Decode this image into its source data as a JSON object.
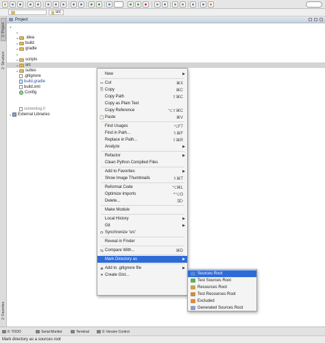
{
  "toolbar": {
    "run_config_value": "",
    "buttons": [
      {
        "name": "open-icon",
        "color": "#c8a24a"
      },
      {
        "name": "save-icon",
        "color": "#6d87b6"
      },
      {
        "name": "sync-icon",
        "color": "#3f8f3f"
      },
      {
        "name": "undo-icon",
        "color": "#7a7a7a"
      },
      {
        "name": "redo-icon",
        "color": "#7a7a7a"
      },
      {
        "name": "cut-icon",
        "color": "#7a7a7a"
      },
      {
        "name": "copy-icon",
        "color": "#7a7a7a"
      },
      {
        "name": "paste-icon",
        "color": "#7a7a7a"
      },
      {
        "name": "find-icon",
        "color": "#5a79b4"
      },
      {
        "name": "replace-icon",
        "color": "#5a79b4"
      },
      {
        "name": "back-icon",
        "color": "#4a8f4a"
      },
      {
        "name": "forward-icon",
        "color": "#4a8f4a"
      },
      {
        "name": "build-icon",
        "color": "#4b7fc0"
      },
      {
        "name": "run-icon",
        "color": "#37a237"
      },
      {
        "name": "debug-icon",
        "color": "#4b9e4b"
      },
      {
        "name": "stop-icon",
        "color": "#c63b3b"
      },
      {
        "name": "settings-icon",
        "color": "#888888"
      },
      {
        "name": "structure-icon",
        "color": "#6f7fa5"
      },
      {
        "name": "sdk-icon",
        "color": "#6aa35b"
      },
      {
        "name": "avd-icon",
        "color": "#6aa35b"
      },
      {
        "name": "monitor-icon",
        "color": "#6f7fa5"
      },
      {
        "name": "help-icon",
        "color": "#5a79b4"
      },
      {
        "name": "vcs-icon",
        "color": "#d08a3a"
      }
    ]
  },
  "breadcrumb": {
    "root": "",
    "current": "src"
  },
  "side_tabs": {
    "project": "1: Project",
    "structure": "2: Structure",
    "favorites": "2: Favorites"
  },
  "project_pane": {
    "title": "Project",
    "tree": [
      {
        "label": "",
        "kind": "blank",
        "indent": 0,
        "twisty": "▾"
      },
      {
        "label": "",
        "kind": "blank",
        "indent": 1,
        "twisty": "▸"
      },
      {
        "label": ".idea",
        "kind": "folder",
        "indent": 1,
        "twisty": "▸"
      },
      {
        "label": "build",
        "kind": "folder",
        "indent": 1,
        "twisty": "▸"
      },
      {
        "label": "gradle",
        "kind": "folder",
        "indent": 1,
        "twisty": "▸"
      },
      {
        "label": "",
        "kind": "blank",
        "indent": 1,
        "twisty": "▸"
      },
      {
        "label": "scripts",
        "kind": "folder",
        "indent": 1,
        "twisty": "▸"
      },
      {
        "label": "src",
        "kind": "folder",
        "indent": 1,
        "twisty": "▸",
        "selected": true
      },
      {
        "label": "suites",
        "kind": "folder",
        "indent": 1,
        "twisty": "▸"
      },
      {
        "label": ".gitignore",
        "kind": "file",
        "indent": 1,
        "twisty": ""
      },
      {
        "label": "build.gradle",
        "kind": "file-blue",
        "indent": 1,
        "twisty": ""
      },
      {
        "label": "build.xml",
        "kind": "file",
        "indent": 1,
        "twisty": ""
      },
      {
        "label": "Config",
        "kind": "gear",
        "indent": 1,
        "twisty": ""
      },
      {
        "label": "",
        "kind": "blank",
        "indent": 1,
        "twisty": ""
      },
      {
        "label": "",
        "kind": "blank",
        "indent": 1,
        "twisty": ""
      },
      {
        "label": "screenlog.0",
        "kind": "file-gray",
        "indent": 1,
        "twisty": ""
      },
      {
        "label": "External Libraries",
        "kind": "lib",
        "indent": 0,
        "twisty": "▸"
      }
    ]
  },
  "context_menu": {
    "items": [
      {
        "label": "New",
        "shortcut": "",
        "submenu": true,
        "icon": ""
      },
      {
        "sep": true
      },
      {
        "label": "Cut",
        "shortcut": "⌘X",
        "icon": "✂"
      },
      {
        "label": "Copy",
        "shortcut": "⌘C",
        "icon": "⎘"
      },
      {
        "label": "Copy Path",
        "shortcut": "⇧⌘C",
        "icon": ""
      },
      {
        "label": "Copy as Plain Text",
        "shortcut": "",
        "icon": ""
      },
      {
        "label": "Copy Reference",
        "shortcut": "⌥⇧⌘C",
        "icon": ""
      },
      {
        "label": "Paste",
        "shortcut": "⌘V",
        "icon": "📋"
      },
      {
        "sep": true
      },
      {
        "label": "Find Usages",
        "shortcut": "⌥F7",
        "icon": ""
      },
      {
        "label": "Find in Path...",
        "shortcut": "⇧⌘F",
        "icon": ""
      },
      {
        "label": "Replace in Path...",
        "shortcut": "⇧⌘R",
        "icon": ""
      },
      {
        "label": "Analyze",
        "shortcut": "",
        "submenu": true,
        "icon": ""
      },
      {
        "sep": true
      },
      {
        "label": "Refactor",
        "shortcut": "",
        "submenu": true,
        "icon": ""
      },
      {
        "label": "Clean Python Compiled Files",
        "shortcut": "",
        "icon": ""
      },
      {
        "sep": true
      },
      {
        "label": "Add to Favorites",
        "shortcut": "",
        "submenu": true,
        "icon": ""
      },
      {
        "label": "Show Image Thumbnails",
        "shortcut": "⇧⌘T",
        "icon": ""
      },
      {
        "sep": true
      },
      {
        "label": "Reformat Code",
        "shortcut": "⌥⌘L",
        "icon": ""
      },
      {
        "label": "Optimize Imports",
        "shortcut": "^⌥O",
        "icon": ""
      },
      {
        "label": "Delete...",
        "shortcut": "⌦",
        "icon": ""
      },
      {
        "sep": true
      },
      {
        "label": "Make Module",
        "shortcut": "",
        "icon": ""
      },
      {
        "sep": true
      },
      {
        "label": "Local History",
        "shortcut": "",
        "submenu": true,
        "icon": ""
      },
      {
        "label": "Git",
        "shortcut": "",
        "submenu": true,
        "icon": ""
      },
      {
        "label": "Synchronize 'src'",
        "shortcut": "",
        "icon": "⟳"
      },
      {
        "sep": true
      },
      {
        "label": "Reveal in Finder",
        "shortcut": "",
        "icon": ""
      },
      {
        "sep": true
      },
      {
        "label": "Compare With...",
        "shortcut": "⌘D",
        "icon": "⇆"
      },
      {
        "sep": true
      },
      {
        "label": "Mark Directory as",
        "shortcut": "",
        "submenu": true,
        "icon": "",
        "highlighted": true
      },
      {
        "sep": true
      },
      {
        "label": "Add to .gitignore file",
        "shortcut": "",
        "submenu": true,
        "icon": "◈"
      },
      {
        "label": "Create Gist...",
        "shortcut": "",
        "icon": "●"
      }
    ]
  },
  "mark_submenu": {
    "items": [
      {
        "label": "Sources Root",
        "color": "#5b84d6",
        "highlighted": true
      },
      {
        "label": "Test Sources Root",
        "color": "#5fae5f"
      },
      {
        "label": "Resources Root",
        "color": "#c9a24e"
      },
      {
        "label": "Test Resources Root",
        "color": "#c98c4e"
      },
      {
        "label": "Excluded",
        "color": "#e28a3b"
      },
      {
        "label": "Generated Sources Root",
        "color": "#8a9fcf"
      }
    ]
  },
  "bottom_tabs": [
    {
      "label": "6: TODO",
      "icon": "todo-icon"
    },
    {
      "label": "Serial Monitor",
      "icon": "serial-monitor-icon"
    },
    {
      "label": "Terminal",
      "icon": "terminal-icon"
    },
    {
      "label": "9: Version Control",
      "icon": "version-control-icon"
    }
  ],
  "status": {
    "text": "Mark directory as a sources root"
  }
}
